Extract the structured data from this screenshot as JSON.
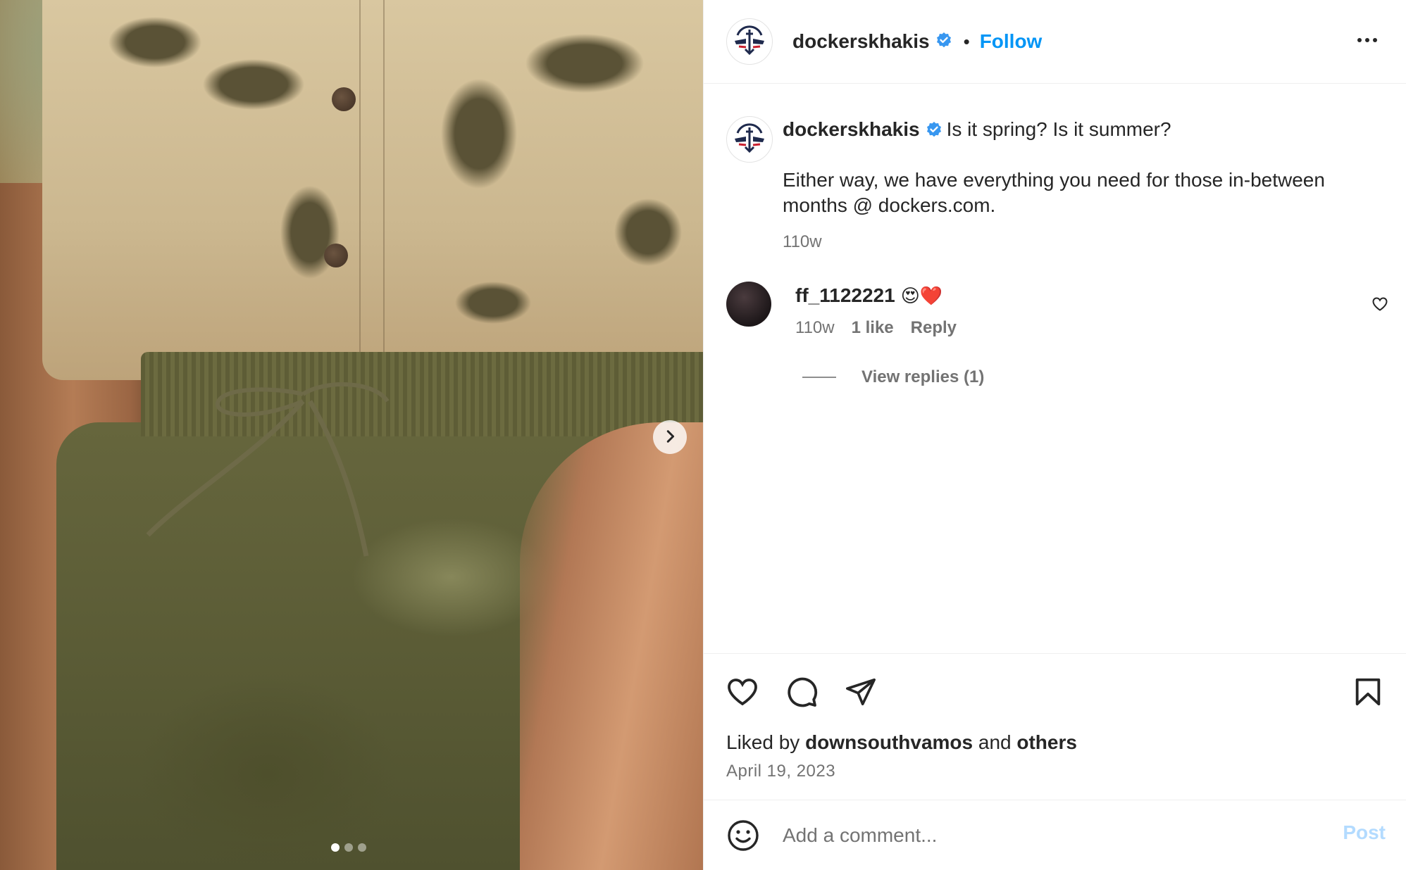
{
  "post": {
    "username": "dockerskhakis",
    "verified": true,
    "follow_label": "Follow",
    "separator": "•"
  },
  "caption": {
    "username": "dockerskhakis",
    "first_line": "Is it spring? Is it summer?",
    "paragraph": "Either way, we have everything you need for those in-between months @ dockers.com.",
    "time": "110w"
  },
  "comment": {
    "username": "ff_1122221",
    "emojis": "😍❤️",
    "time": "110w",
    "likes": "1 like",
    "reply_label": "Reply",
    "view_replies": "View replies (1)"
  },
  "likes": {
    "prefix": "Liked by",
    "user": "downsouthvamos",
    "middle": "and",
    "others": "others"
  },
  "date": "April 19, 2023",
  "composer": {
    "placeholder": "Add a comment...",
    "post_label": "Post"
  },
  "carousel": {
    "total": 3,
    "active": 1
  },
  "colors": {
    "accent": "#0095f6",
    "verified": "#3897f0",
    "muted": "#737373",
    "post_disabled": "#b3dbff"
  },
  "icons": {
    "header": [
      "logo-icon",
      "verified-badge-icon",
      "more-options-icon"
    ],
    "actions": [
      "heart-icon",
      "comment-icon",
      "share-icon",
      "bookmark-icon"
    ],
    "media": [
      "chevron-right-icon"
    ],
    "composer": [
      "emoji-icon"
    ]
  }
}
